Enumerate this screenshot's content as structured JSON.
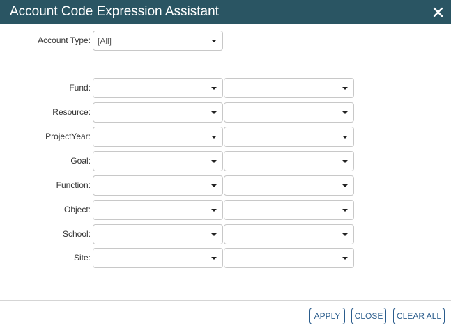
{
  "dialog": {
    "title": "Account Code Expression Assistant",
    "close_icon": "close-icon"
  },
  "account_type": {
    "label": "Account Type:",
    "value": "[All]"
  },
  "segments": [
    {
      "label": "Fund:",
      "from": "",
      "to": ""
    },
    {
      "label": "Resource:",
      "from": "",
      "to": ""
    },
    {
      "label": "ProjectYear:",
      "from": "",
      "to": ""
    },
    {
      "label": "Goal:",
      "from": "",
      "to": ""
    },
    {
      "label": "Function:",
      "from": "",
      "to": ""
    },
    {
      "label": "Object:",
      "from": "",
      "to": ""
    },
    {
      "label": "School:",
      "from": "",
      "to": ""
    },
    {
      "label": "Site:",
      "from": "",
      "to": ""
    }
  ],
  "footer": {
    "apply_label": "APPLY",
    "close_label": "CLOSE",
    "clear_all_label": "CLEAR ALL"
  },
  "colors": {
    "titlebar": "#2a5563",
    "button_accent": "#2a5c8c"
  }
}
